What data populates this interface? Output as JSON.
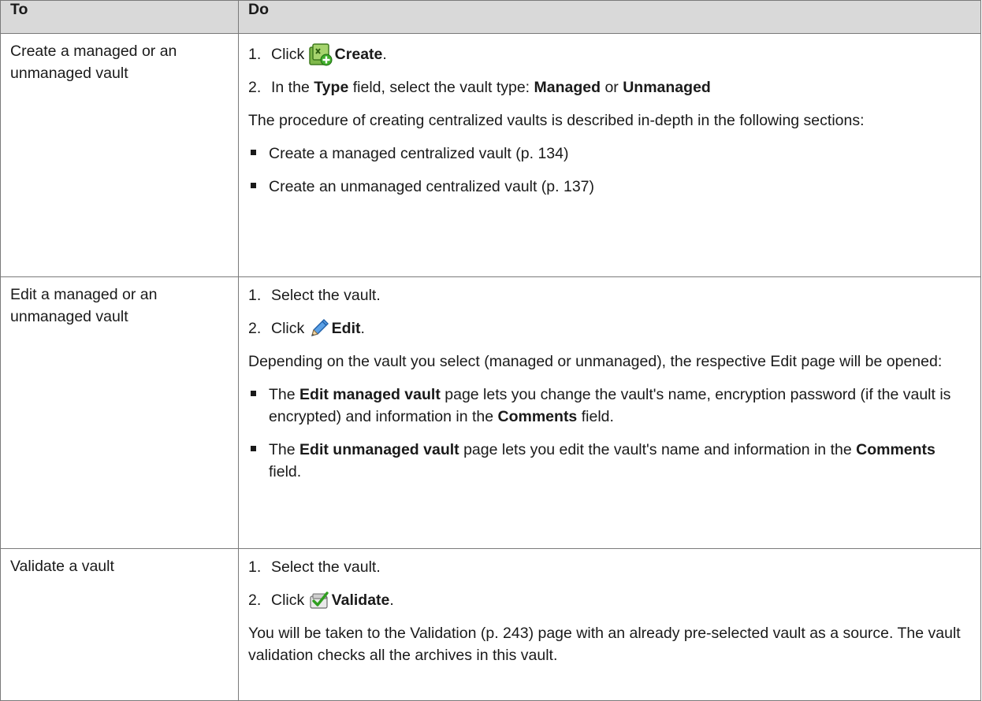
{
  "header": {
    "col_to": "To",
    "col_do": "Do"
  },
  "rows": [
    {
      "to": "Create a managed or an unmanaged vault",
      "step1": {
        "num": "1.",
        "pre": "Click",
        "action": "Create",
        "post": "."
      },
      "step2": {
        "num": "2.",
        "pre": "In the",
        "field": "Type",
        "mid": "field, select the vault type:",
        "opt1": "Managed",
        "or": "or",
        "opt2": "Unmanaged"
      },
      "para": "The procedure of creating centralized vaults is described in-depth in the following sections:",
      "bullets": [
        "Create a managed centralized vault (p. 134)",
        "Create an unmanaged centralized vault (p. 137)"
      ]
    },
    {
      "to": "Edit a managed or an unmanaged vault",
      "step1": {
        "num": "1.",
        "text": "Select the vault."
      },
      "step2": {
        "num": "2.",
        "pre": "Click",
        "action": "Edit",
        "post": "."
      },
      "para": "Depending on the vault you select (managed or unmanaged), the respective Edit page will be opened:",
      "bullet1": {
        "pre": "The",
        "bold": "Edit managed vault",
        "mid": "page lets you change the vault's name, encryption password (if the vault is encrypted) and information in the",
        "bold2": "Comments",
        "post": "field."
      },
      "bullet2": {
        "pre": "The",
        "bold": "Edit unmanaged vault",
        "mid": "page lets you edit the vault's name and information in the",
        "bold2": "Comments",
        "post": "field."
      }
    },
    {
      "to": "Validate a vault",
      "step1": {
        "num": "1.",
        "text": "Select the vault."
      },
      "step2": {
        "num": "2.",
        "pre": "Click",
        "action": "Validate",
        "post": "."
      },
      "para": "You will be taken to the Validation (p. 243) page with an already pre-selected vault as a source. The vault validation checks all the archives in this vault."
    }
  ],
  "icons": {
    "create": "create-vault-icon",
    "edit": "pencil-edit-icon",
    "validate": "validate-check-icon"
  }
}
